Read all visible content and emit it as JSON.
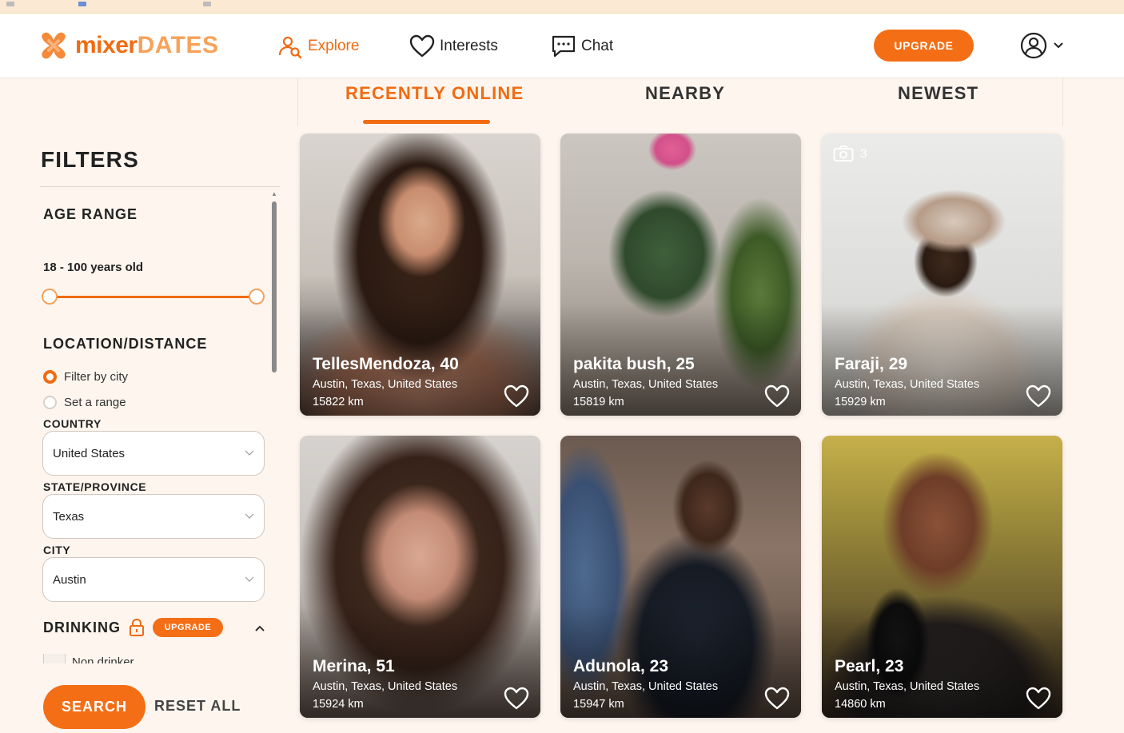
{
  "brand": {
    "name_part1": "mixer",
    "name_part2": "DATES",
    "accent": "#f06b12",
    "accent_light": "#f7a25a"
  },
  "nav": {
    "explore": "Explore",
    "interests": "Interests",
    "chat": "Chat",
    "upgrade": "UPGRADE"
  },
  "tabs": [
    {
      "label": "RECENTLY ONLINE",
      "active": true
    },
    {
      "label": "NEARBY",
      "active": false
    },
    {
      "label": "NEWEST",
      "active": false
    }
  ],
  "filters": {
    "title": "FILTERS",
    "age": {
      "title": "AGE RANGE",
      "value_text": "18 - 100 years old",
      "min": 18,
      "max": 100
    },
    "location": {
      "title": "LOCATION/DISTANCE",
      "option_city": "Filter by city",
      "option_range": "Set a range",
      "selected": "Filter by city",
      "country_label": "COUNTRY",
      "country_value": "United States",
      "state_label": "STATE/PROVINCE",
      "state_value": "Texas",
      "city_label": "CITY",
      "city_value": "Austin"
    },
    "drinking": {
      "title": "DRINKING",
      "upgrade": "UPGRADE",
      "option1": "Non drinker"
    },
    "search": "SEARCH",
    "reset": "RESET ALL"
  },
  "profiles": [
    {
      "name": "TellesMendoza, 40",
      "location": "Austin, Texas, United States",
      "distance": "15822 km",
      "photo_count": ""
    },
    {
      "name": "pakita bush, 25",
      "location": "Austin, Texas, United States",
      "distance": "15819 km",
      "photo_count": ""
    },
    {
      "name": "Faraji, 29",
      "location": "Austin, Texas, United States",
      "distance": "15929 km",
      "photo_count": "3"
    },
    {
      "name": "Merina, 51",
      "location": "Austin, Texas, United States",
      "distance": "15924 km",
      "photo_count": ""
    },
    {
      "name": "Adunola, 23",
      "location": "Austin, Texas, United States",
      "distance": "15947 km",
      "photo_count": ""
    },
    {
      "name": "Pearl, 23",
      "location": "Austin, Texas, United States",
      "distance": "14860 km",
      "photo_count": ""
    }
  ]
}
